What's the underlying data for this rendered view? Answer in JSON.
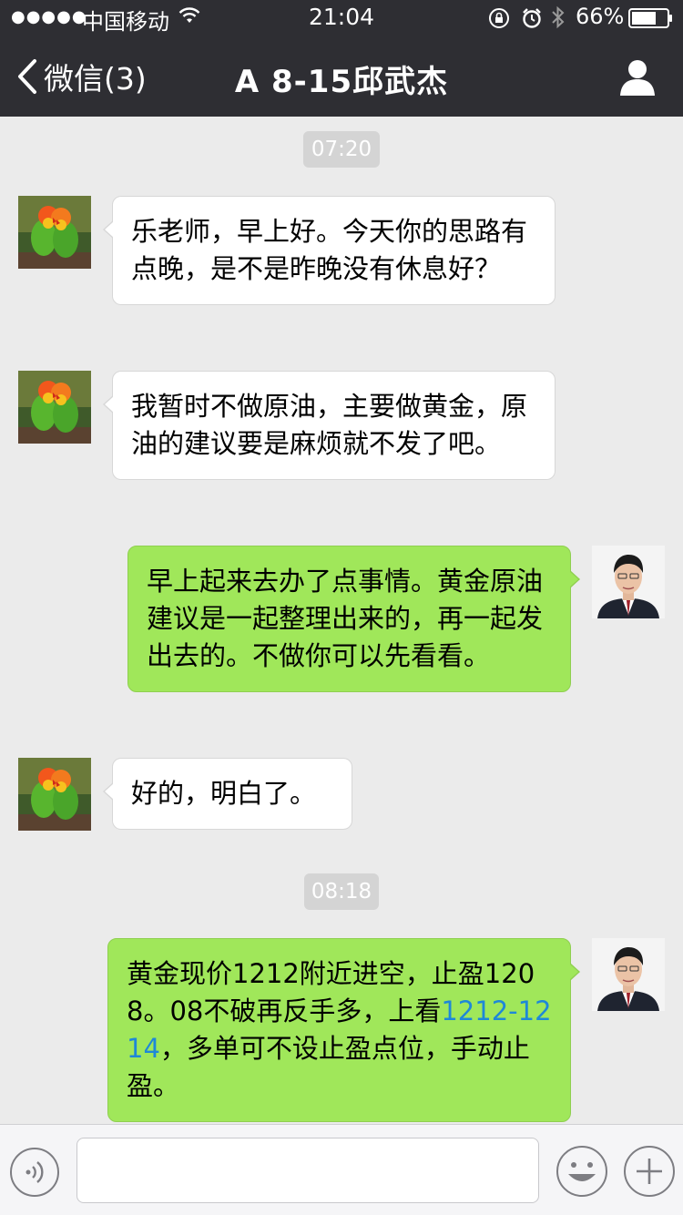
{
  "status_bar": {
    "signal": "●●●●●",
    "carrier": "中国移动",
    "time": "21:04",
    "battery_percent": "66%"
  },
  "nav": {
    "back_label": "微信(3)",
    "title": "A  8-15邱武杰"
  },
  "chat": {
    "timestamps": [
      "07:20",
      "08:18"
    ],
    "messages": [
      {
        "side": "in",
        "avatar": "parrots-avatar",
        "text": "乐老师，早上好。今天你的思路有点晚，是不是昨晚没有休息好？"
      },
      {
        "side": "in",
        "avatar": "parrots-avatar",
        "text": "我暂时不做原油，主要做黄金，原油的建议要是麻烦就不发了吧。"
      },
      {
        "side": "out",
        "avatar": "man-portrait-avatar",
        "text": "早上起来去办了点事情。黄金原油建议是一起整理出来的，再一起发出去的。不做你可以先看看。"
      },
      {
        "side": "in",
        "avatar": "parrots-avatar",
        "text": "好的，明白了。"
      },
      {
        "side": "out",
        "avatar": "man-portrait-avatar",
        "text_before": "黄金现价1212附近进空，止盈1208。08不破再反手多，上看",
        "link": "1212-1214",
        "text_after": "，多单可不设止盈点位，手动止盈。"
      }
    ]
  },
  "input_bar": {
    "text_value": ""
  },
  "colors": {
    "header_bg": "#2e2e33",
    "chat_bg": "#ebebeb",
    "outgoing_bubble": "#a0e75a",
    "incoming_bubble": "#ffffff",
    "link": "#1e88d8"
  },
  "icons": [
    "wifi-icon",
    "rotation-lock-icon",
    "alarm-icon",
    "bluetooth-icon",
    "battery-icon",
    "back-chevron-icon",
    "profile-icon",
    "voice-icon",
    "emoji-icon",
    "plus-icon"
  ]
}
